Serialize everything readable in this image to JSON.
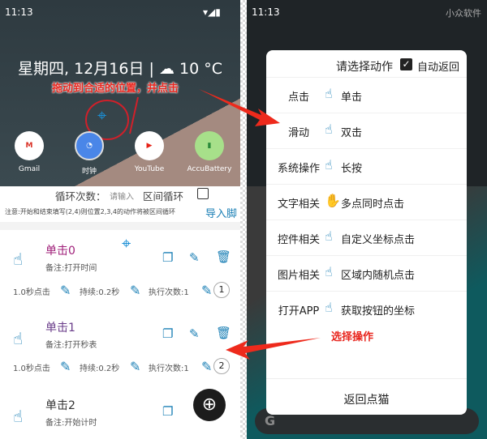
{
  "left": {
    "status": {
      "time": "11:13"
    },
    "home": {
      "date": "星期四, 12月16日",
      "separator": "|",
      "temp": "10 °C",
      "apps": [
        {
          "label": "Gmail"
        },
        {
          "label": "时钟"
        },
        {
          "label": "YouTube"
        },
        {
          "label": "AccuBattery"
        }
      ]
    },
    "annotation": "拖动到合适的位置，并点击",
    "loop": {
      "label": "循环次数：",
      "placeholder": "请输入",
      "range_label": "区间循环",
      "range_checked": false
    },
    "note": "注意:开始和结束填写(2,4)则位置2,3,4的动作将被区间循环",
    "import_label": "导入脚",
    "items": [
      {
        "title": "单击0",
        "note": "备注:打开时间",
        "delay": "1.0秒点击",
        "duration": "持续:0.2秒",
        "count": "执行次数:1",
        "index": "1",
        "title_color": "#a0207a"
      },
      {
        "title": "单击1",
        "note": "备注:打开秒表",
        "delay": "1.0秒点击",
        "duration": "持续:0.2秒",
        "count": "执行次数:1",
        "index": "2",
        "title_color": "#6a3d8a"
      },
      {
        "title": "单击2",
        "note": "备注:开始计时",
        "title_color": "#333"
      }
    ]
  },
  "right": {
    "status": {
      "time": "11:13"
    },
    "watermark": "小众软件",
    "dialog": {
      "title": "请选择动作",
      "auto_return_label": "自动返回",
      "auto_return_checked": true,
      "categories": [
        "点击",
        "滑动",
        "系统操作",
        "文字相关",
        "控件相关",
        "图片相关",
        "打开APP"
      ],
      "actions": [
        "单击",
        "双击",
        "长按",
        "多点同时点击",
        "自定义坐标点击",
        "区域内随机点击",
        "获取按钮的坐标"
      ],
      "back_label": "返回点猫"
    },
    "annotation": "选择操作"
  },
  "colors": {
    "accent": "#1a7fb5",
    "annotation": "#e8261e"
  }
}
